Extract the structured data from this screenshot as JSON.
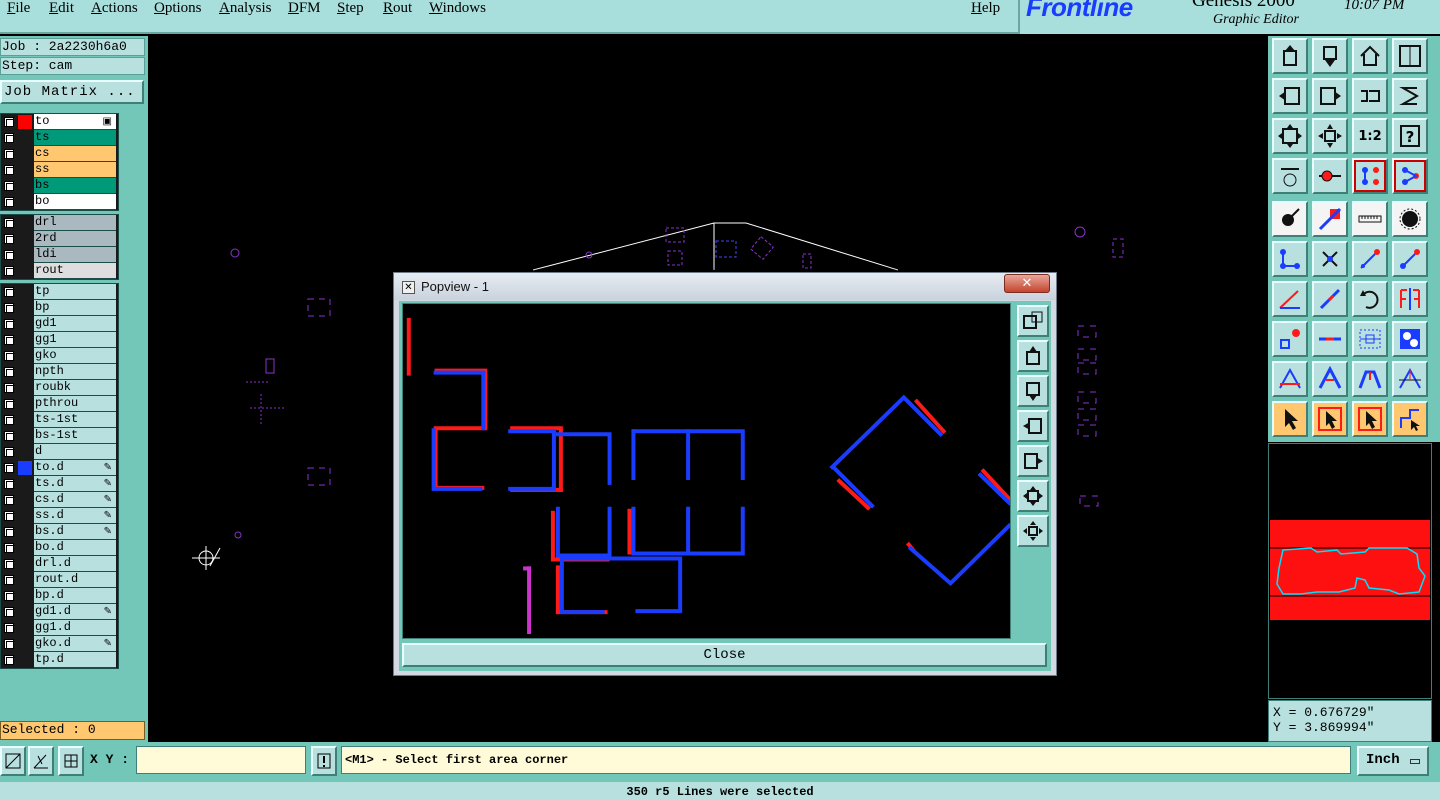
{
  "menubar": {
    "items": [
      "File",
      "Edit",
      "Actions",
      "Options",
      "Analysis",
      "DFM",
      "Step",
      "Rout",
      "Windows"
    ],
    "help": "Help"
  },
  "brand": {
    "logo": "Frontline",
    "title": "Genesis 2000",
    "subtitle": "Graphic Editor",
    "clock": "10:07 PM"
  },
  "job": {
    "job_label": "Job : 2a2230h6a0",
    "step_label": "Step: cam",
    "matrix_button": "Job Matrix ..."
  },
  "layers": {
    "groups": [
      [
        {
          "name": "to",
          "color": "#ff0000",
          "bg": "#ffffff",
          "mark": "▣",
          "active": true
        },
        {
          "name": "ts",
          "color": "",
          "bg": "#009a7a",
          "mark": ""
        },
        {
          "name": "cs",
          "color": "",
          "bg": "#ffc870",
          "mark": ""
        },
        {
          "name": "ss",
          "color": "",
          "bg": "#ffc870",
          "mark": ""
        },
        {
          "name": "bs",
          "color": "",
          "bg": "#009a7a",
          "mark": ""
        },
        {
          "name": "bo",
          "color": "",
          "bg": "#ffffff",
          "mark": ""
        }
      ],
      [
        {
          "name": "drl",
          "color": "",
          "bg": "#aab8c0",
          "mark": ""
        },
        {
          "name": "2rd",
          "color": "",
          "bg": "#aab8c0",
          "mark": ""
        },
        {
          "name": "ldi",
          "color": "",
          "bg": "#aab8c0",
          "mark": ""
        },
        {
          "name": "rout",
          "color": "",
          "bg": "#dedede",
          "mark": ""
        }
      ],
      [
        {
          "name": "tp",
          "color": "",
          "bg": "#b7e0df",
          "mark": ""
        },
        {
          "name": "bp",
          "color": "",
          "bg": "#b7e0df",
          "mark": ""
        },
        {
          "name": "gd1",
          "color": "",
          "bg": "#b7e0df",
          "mark": ""
        },
        {
          "name": "gg1",
          "color": "",
          "bg": "#b7e0df",
          "mark": ""
        },
        {
          "name": "gko",
          "color": "",
          "bg": "#b7e0df",
          "mark": ""
        },
        {
          "name": "npth",
          "color": "",
          "bg": "#b7e0df",
          "mark": ""
        },
        {
          "name": "roubk",
          "color": "",
          "bg": "#b7e0df",
          "mark": ""
        },
        {
          "name": "pthrou",
          "color": "",
          "bg": "#b7e0df",
          "mark": ""
        },
        {
          "name": "ts-1st",
          "color": "",
          "bg": "#b7e0df",
          "mark": ""
        },
        {
          "name": "bs-1st",
          "color": "",
          "bg": "#b7e0df",
          "mark": ""
        },
        {
          "name": "d",
          "color": "",
          "bg": "#b7e0df",
          "mark": ""
        },
        {
          "name": "to.d",
          "color": "#1a3cff",
          "bg": "#b7e0df",
          "mark": "✎"
        },
        {
          "name": "ts.d",
          "color": "",
          "bg": "#b7e0df",
          "mark": "✎"
        },
        {
          "name": "cs.d",
          "color": "",
          "bg": "#b7e0df",
          "mark": "✎"
        },
        {
          "name": "ss.d",
          "color": "",
          "bg": "#b7e0df",
          "mark": "✎"
        },
        {
          "name": "bs.d",
          "color": "",
          "bg": "#b7e0df",
          "mark": "✎"
        },
        {
          "name": "bo.d",
          "color": "",
          "bg": "#b7e0df",
          "mark": ""
        },
        {
          "name": "drl.d",
          "color": "",
          "bg": "#b7e0df",
          "mark": ""
        },
        {
          "name": "rout.d",
          "color": "",
          "bg": "#b7e0df",
          "mark": ""
        },
        {
          "name": "bp.d",
          "color": "",
          "bg": "#b7e0df",
          "mark": ""
        },
        {
          "name": "gd1.d",
          "color": "",
          "bg": "#b7e0df",
          "mark": "✎"
        },
        {
          "name": "gg1.d",
          "color": "",
          "bg": "#b7e0df",
          "mark": ""
        },
        {
          "name": "gko.d",
          "color": "",
          "bg": "#b7e0df",
          "mark": "✎"
        },
        {
          "name": "tp.d",
          "color": "",
          "bg": "#b7e0df",
          "mark": ""
        }
      ]
    ]
  },
  "selection": {
    "label": "Selected : 0"
  },
  "coordinates": {
    "x": "X = 0.676729\"",
    "y": "Y = 3.869994\""
  },
  "bottombar": {
    "xy_label": "X Y :",
    "xy_value": "",
    "prompt": "<M1> - Select first area corner",
    "unit": "Inch"
  },
  "status": {
    "message": "350 r5 Lines were selected"
  },
  "popview": {
    "title": "Popview - 1",
    "close_button": "Close",
    "close_x": "✕"
  },
  "colors": {
    "panel": "#73c7b8",
    "field": "#b7e0df",
    "highlight": "#ffc870",
    "feature_blue": "#1a3cff",
    "feature_red": "#ff1a1a",
    "feature_magenta": "#cc33cc"
  },
  "right_toolbar": {
    "icons": [
      "pop-up-icon",
      "pop-down-icon",
      "home-icon",
      "split-view-icon",
      "pan-left-icon",
      "pan-right-icon",
      "rotate-view-icon",
      "redraw-icon",
      "zoom-fit-icon",
      "zoom-center-icon",
      "zoom-1to1-icon",
      "query-icon",
      "measure-probe-icon",
      "snap-pad-icon",
      "net-select-icon",
      "net-connect-icon",
      "pad-icon",
      "line-icon",
      "ruler-icon",
      "round-pad-icon",
      "connect-dots-icon",
      "cross-icon",
      "line-select-icon",
      "line-add-icon",
      "angle-icon",
      "diagonal-icon",
      "arc-icon",
      "mirror-icon",
      "pad-to-line-icon",
      "line-dash-icon",
      "gap-icon",
      "cluster-icon",
      "shape-a-icon",
      "shape-b-icon",
      "shape-c-icon",
      "shape-d-icon",
      "pointer-icon",
      "pointer-select-icon",
      "pointer-edit-icon",
      "route-icon"
    ],
    "zoom_label": "1:2"
  },
  "popview_tools": {
    "icons": [
      "window-switch-icon",
      "pop-up-icon",
      "pop-down-icon",
      "pan-left-icon",
      "pan-right-icon",
      "zoom-in-icon",
      "zoom-out-icon"
    ]
  }
}
